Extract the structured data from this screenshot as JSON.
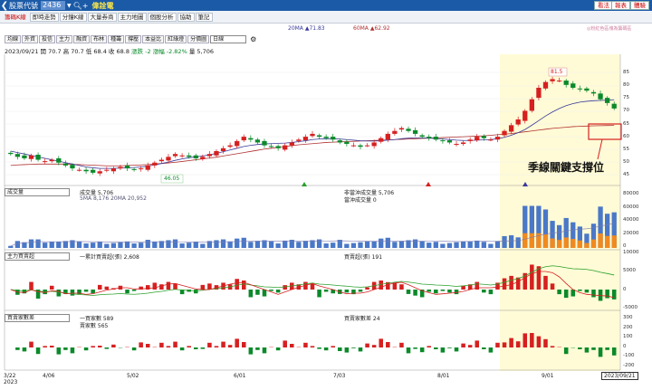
{
  "topbar": {
    "label": "股票代號",
    "code": "2436",
    "stock_name": "偉詮電",
    "buttons": [
      "看法",
      "報表",
      "體驗"
    ]
  },
  "menu": [
    "籌碼K線",
    "即時走勢",
    "分鐘K線",
    "大量券商",
    "主力地圖",
    "個股分析",
    "協助",
    "筆記"
  ],
  "ma_legend": {
    "ma20": "20MA ▲71.83",
    "ma60": "60MA ▲62.92",
    "note": "◎粉紅色區塊為籌碼區"
  },
  "tabs": [
    "均線",
    "外資",
    "投信",
    "主力",
    "融資",
    "布林",
    "種籌",
    "撐壓",
    "本益比",
    "紅綠燈",
    "分價圖"
  ],
  "tab_select": "日線",
  "ohlc": {
    "date": "2023/09/21",
    "open": "開 70.7",
    "high": "高 70.7",
    "low": "低 68.4",
    "close": "收 68.8",
    "change": "漲跌 -2",
    "pct": "漲幅 -2.82%",
    "vol": "量 5,706"
  },
  "price_labels": {
    "high": "81.5",
    "low": "46.05"
  },
  "annotation": "季線關鍵支撐位",
  "vol_panel": {
    "select": "成交量",
    "vol": "成交量 5,706",
    "sma": "5MA 8,176",
    "ma20": "20MA 20,952",
    "nonday": "非當沖成交量 5,706",
    "day": "當沖成交量 0"
  },
  "main_panel": {
    "select": "主力買賣超",
    "cum": "一累計買賣超(張) 2,608",
    "daily": "買賣超(張) 191"
  },
  "broker_panel": {
    "select": "買賣家數差",
    "buyers": "一買家數 589",
    "sellers": "賣家數 565",
    "diff": "買賣家數差 24"
  },
  "price_axis": [
    "85",
    "80",
    "75",
    "70",
    "65",
    "60",
    "55",
    "50",
    "45"
  ],
  "vol_axis": [
    "80000",
    "60000",
    "40000",
    "20000",
    "0"
  ],
  "main_axis": [
    "10000",
    "5000",
    "0",
    "-5000"
  ],
  "broker_axis": [
    "300",
    "200",
    "100",
    "0",
    "-100",
    "-200"
  ],
  "xaxis": [
    "3/22\n2023",
    "4/06",
    "5/02",
    "6/01",
    "7/03",
    "8/01",
    "9/01"
  ],
  "current_date": "2023/09/21",
  "chart_data": {
    "type": "candlestick",
    "closes": [
      53,
      52,
      51.5,
      52.5,
      51,
      50.5,
      51,
      50,
      49,
      48,
      47.5,
      47,
      46.5,
      47,
      47.5,
      48,
      48.5,
      48,
      47.5,
      48,
      49,
      50,
      51,
      52,
      53,
      52.5,
      52,
      51.5,
      52,
      53,
      54,
      55,
      56,
      57.5,
      59,
      58,
      57,
      56,
      55.5,
      55,
      56,
      57,
      58,
      59,
      60,
      59,
      58.5,
      58,
      57,
      56.5,
      56,
      55.5,
      56,
      57,
      58.5,
      60,
      61,
      62,
      61,
      60,
      59,
      58.5,
      58,
      57.5,
      57,
      56.5,
      57,
      58,
      59,
      58.5,
      58,
      59,
      61,
      63,
      65,
      68,
      72,
      76,
      78,
      79,
      78.5,
      77,
      76,
      75.5,
      75,
      74,
      72,
      70.7,
      68.8
    ],
    "ma20": [
      54,
      53.5,
      53,
      52.5,
      52,
      51.5,
      51,
      50.5,
      50,
      49.5,
      49,
      48.5,
      48.2,
      48,
      48,
      48,
      48.1,
      48.2,
      48.3,
      48.5,
      48.8,
      49.2,
      49.7,
      50.2,
      50.8,
      51.3,
      51.7,
      52,
      52.3,
      52.7,
      53.2,
      53.8,
      54.4,
      55,
      55.6,
      56,
      56.3,
      56.5,
      56.6,
      56.7,
      56.8,
      57,
      57.3,
      57.6,
      58,
      58.2,
      58.3,
      58.3,
      58.2,
      58,
      57.8,
      57.6,
      57.5,
      57.5,
      57.6,
      57.8,
      58,
      58.3,
      58.5,
      58.6,
      58.6,
      58.5,
      58.4,
      58.2,
      58,
      57.8,
      57.7,
      57.7,
      57.8,
      57.9,
      58,
      58.3,
      58.8,
      59.5,
      60.4,
      61.5,
      63,
      64.6,
      66.2,
      67.6,
      68.8,
      69.8,
      70.5,
      71,
      71.3,
      71.5,
      71.6,
      71.7,
      71.83
    ],
    "ma60": [
      49,
      49.2,
      49.3,
      49.4,
      49.5,
      49.5,
      49.5,
      49.5,
      49.5,
      49.4,
      49.3,
      49.2,
      49.1,
      49,
      48.9,
      48.9,
      48.9,
      49,
      49.1,
      49.2,
      49.3,
      49.5,
      49.7,
      49.9,
      50.1,
      50.4,
      50.7,
      51,
      51.3,
      51.6,
      51.9,
      52.3,
      52.7,
      53.1,
      53.5,
      53.9,
      54.3,
      54.7,
      55,
      55.3,
      55.6,
      55.9,
      56.2,
      56.4,
      56.6,
      56.8,
      57,
      57.1,
      57.2,
      57.3,
      57.4,
      57.5,
      57.6,
      57.7,
      57.8,
      57.9,
      58,
      58.1,
      58.2,
      58.3,
      58.4,
      58.5,
      58.6,
      58.7,
      58.8,
      58.9,
      59,
      59.1,
      59.2,
      59.3,
      59.5,
      59.7,
      59.9,
      60.1,
      60.4,
      60.7,
      61,
      61.3,
      61.6,
      61.9,
      62.1,
      62.3,
      62.5,
      62.6,
      62.7,
      62.8,
      62.85,
      62.9,
      62.92
    ]
  },
  "colors": {
    "up": "#d62020",
    "down": "#0a8a2a",
    "ma20": "#3a3a9a",
    "ma60": "#b03030",
    "highlight": "#fffbd6",
    "topbar": "#1b5aa6"
  }
}
